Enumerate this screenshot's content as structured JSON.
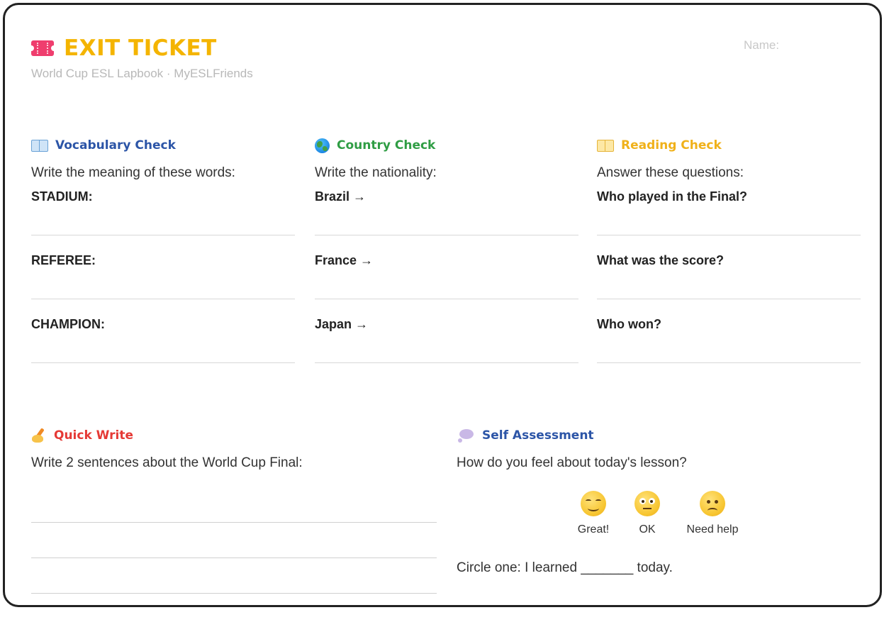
{
  "header": {
    "title": "EXIT TICKET",
    "subtitle": "World Cup ESL Lapbook · MyESLFriends",
    "name_label": "Name:",
    "title_icon": "ticket-icon",
    "title_color": "#f4b400"
  },
  "sections": {
    "vocabulary": {
      "icon": "open-book-icon",
      "title": "Vocabulary Check",
      "color": "#2c55a7",
      "instruction": "Write the meaning of these words:",
      "items": [
        "STADIUM:",
        "REFEREE:",
        "CHAMPION:"
      ]
    },
    "country": {
      "icon": "globe-icon",
      "title": "Country Check",
      "color": "#2f9d44",
      "instruction": "Write the nationality:",
      "items": [
        "Brazil →",
        "France →",
        "Japan →"
      ]
    },
    "reading": {
      "icon": "open-book-icon",
      "title": "Reading Check",
      "color": "#f0b11a",
      "instruction": "Answer these questions:",
      "items": [
        "Who played in the Final?",
        "What was the score?",
        "Who won?"
      ]
    },
    "quick_write": {
      "icon": "writing-hand-icon",
      "title": "Quick Write",
      "color": "#e53935",
      "instruction": "Write 2 sentences about the World Cup Final:"
    },
    "self_assessment": {
      "icon": "thought-bubble-icon",
      "title": "Self Assessment",
      "color": "#2c55a7",
      "instruction": "How do you feel about today's lesson?",
      "faces": [
        {
          "icon": "smiling-face-icon",
          "label": "Great!"
        },
        {
          "icon": "neutral-face-icon",
          "label": "OK"
        },
        {
          "icon": "worried-face-icon",
          "label": "Need help"
        }
      ],
      "circle_line": "Circle one: I learned _______ today."
    }
  }
}
